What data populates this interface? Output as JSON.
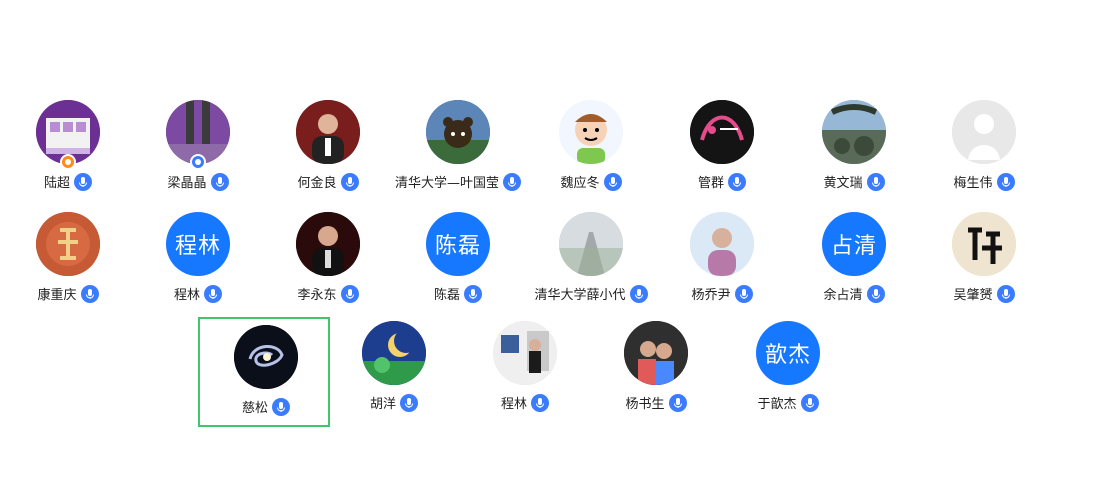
{
  "participants": [
    {
      "name": "陆超",
      "avatar_text": "",
      "has_badge": true,
      "badge_color": "#ff8c1a",
      "photo": "room"
    },
    {
      "name": "梁晶晶",
      "avatar_text": "",
      "has_badge": true,
      "badge_color": "#3b7cff",
      "photo": "street"
    },
    {
      "name": "何金良",
      "avatar_text": "",
      "has_badge": false,
      "photo": "man"
    },
    {
      "name": "清华大学—叶国莹",
      "avatar_text": "",
      "has_badge": false,
      "photo": "bear"
    },
    {
      "name": "魏应冬",
      "avatar_text": "",
      "has_badge": false,
      "photo": "cartoon"
    },
    {
      "name": "管群",
      "avatar_text": "",
      "has_badge": false,
      "photo": "dark"
    },
    {
      "name": "黄文瑞",
      "avatar_text": "",
      "has_badge": false,
      "photo": "coast"
    },
    {
      "name": "梅生伟",
      "avatar_text": "",
      "has_badge": false,
      "photo": "default"
    },
    {
      "name": "康重庆",
      "avatar_text": "",
      "has_badge": false,
      "photo": "calligraphy-red"
    },
    {
      "name": "程林",
      "avatar_text": "程林",
      "has_badge": false,
      "photo": "text"
    },
    {
      "name": "李永东",
      "avatar_text": "",
      "has_badge": false,
      "photo": "man"
    },
    {
      "name": "陈磊",
      "avatar_text": "陈磊",
      "has_badge": false,
      "photo": "text"
    },
    {
      "name": "清华大学薛小代",
      "avatar_text": "",
      "has_badge": false,
      "photo": "road"
    },
    {
      "name": "杨乔尹",
      "avatar_text": "",
      "has_badge": false,
      "photo": "woman"
    },
    {
      "name": "余占清",
      "avatar_text": "占清",
      "has_badge": false,
      "photo": "text"
    },
    {
      "name": "吴肇赟",
      "avatar_text": "",
      "has_badge": false,
      "photo": "calligraphy-black"
    },
    {
      "name": "慈松",
      "avatar_text": "",
      "has_badge": false,
      "photo": "galaxy",
      "selected": true
    },
    {
      "name": "胡洋",
      "avatar_text": "",
      "has_badge": false,
      "photo": "moon"
    },
    {
      "name": "程林",
      "avatar_text": "",
      "has_badge": false,
      "photo": "office"
    },
    {
      "name": "杨书生",
      "avatar_text": "",
      "has_badge": false,
      "photo": "family"
    },
    {
      "name": "于歆杰",
      "avatar_text": "歆杰",
      "has_badge": false,
      "photo": "text"
    }
  ],
  "colors": {
    "text_avatar_bg": "#1677ff",
    "mic_blue": "#3b7cff",
    "selection_border": "#43c56b"
  }
}
